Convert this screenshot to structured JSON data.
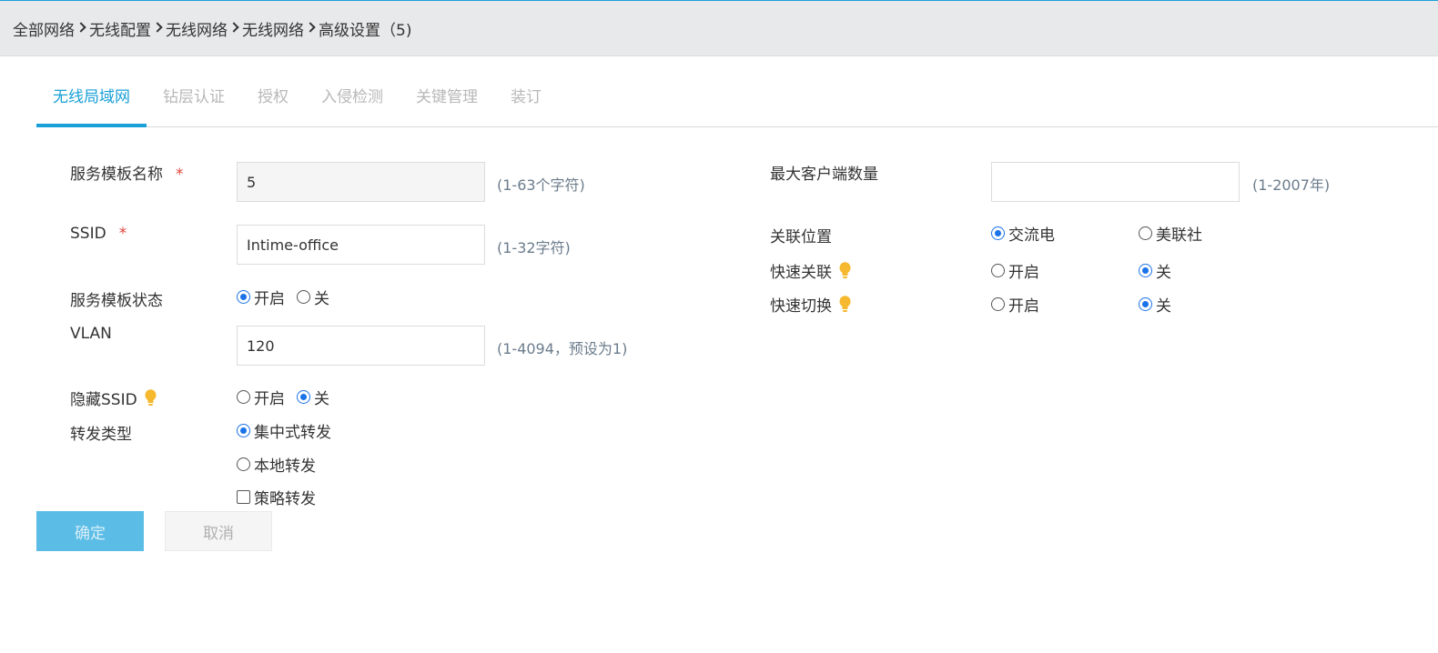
{
  "breadcrumb": [
    "全部网络",
    "无线配置",
    "无线网络",
    "无线网络",
    "高级设置（5)"
  ],
  "tabs": [
    {
      "label": "无线局域网",
      "active": true
    },
    {
      "label": "钻层认证",
      "active": false
    },
    {
      "label": "授权",
      "active": false
    },
    {
      "label": "入侵检测",
      "active": false
    },
    {
      "label": "关键管理",
      "active": false
    },
    {
      "label": "装订",
      "active": false
    }
  ],
  "form": {
    "template_name": {
      "label": "服务模板名称",
      "required": "*",
      "value": "5",
      "hint": "(1-63个字符)"
    },
    "ssid": {
      "label": "SSID",
      "required": "*",
      "value": "Intime-office",
      "hint": "(1-32字符)"
    },
    "template_status": {
      "label": "服务模板状态",
      "options": [
        "开启",
        "关"
      ],
      "selected": "开启"
    },
    "vlan": {
      "label": "VLAN",
      "value": "120",
      "hint": "(1-4094，预设为1)"
    },
    "hide_ssid": {
      "label": "隐藏SSID",
      "options": [
        "开启",
        "关"
      ],
      "selected": "关"
    },
    "forward_type": {
      "label": "转发类型",
      "options": [
        "集中式转发",
        "本地转发"
      ],
      "selected": "集中式转发",
      "checkbox_label": "策略转发",
      "checkbox_checked": false
    },
    "max_clients": {
      "label": "最大客户端数量",
      "value": "",
      "hint": "(1-2007年)"
    },
    "assoc_location": {
      "label": "关联位置",
      "options": [
        "交流电",
        "美联社"
      ],
      "selected": "交流电"
    },
    "fast_assoc": {
      "label": "快速关联",
      "options": [
        "开启",
        "关"
      ],
      "selected": "关"
    },
    "fast_switch": {
      "label": "快速切换",
      "options": [
        "开启",
        "关"
      ],
      "selected": "关"
    }
  },
  "buttons": {
    "confirm": "确定",
    "cancel": "取消"
  },
  "colors": {
    "accent": "#1aa0d8",
    "radio": "#1a73e8",
    "required": "#e0443a",
    "bulb": "#f5b82e"
  }
}
